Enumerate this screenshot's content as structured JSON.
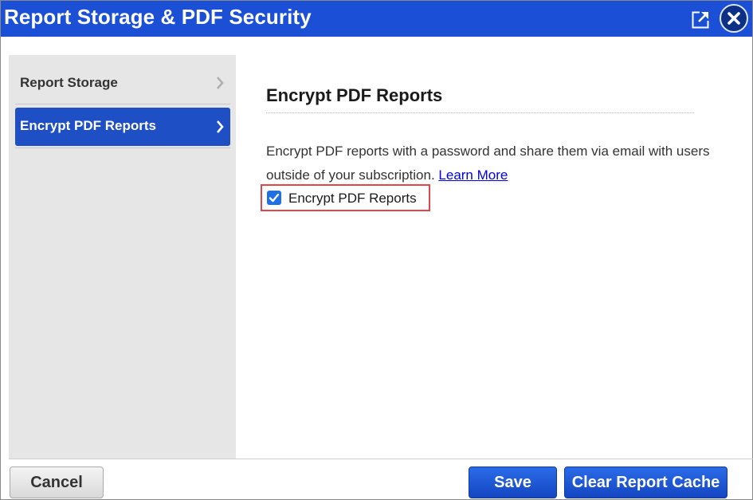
{
  "window": {
    "title": "Report Storage & PDF Security",
    "popout_icon": "popout-icon",
    "close_icon": "close-icon"
  },
  "sidebar": {
    "items": [
      {
        "label": "Report Storage",
        "selected": false
      },
      {
        "label": "Encrypt PDF Reports",
        "selected": true
      }
    ]
  },
  "main": {
    "heading": "Encrypt PDF Reports",
    "description": "Encrypt PDF reports with a password and share them via email with users outside of your subscription.",
    "learn_more": "Learn More",
    "checkbox": {
      "label": "Encrypt PDF Reports",
      "checked": true
    }
  },
  "footer": {
    "cancel_label": "Cancel",
    "save_label": "Save",
    "clear_cache_label": "Clear Report Cache"
  },
  "colors": {
    "titlebar": "#1a4fd6",
    "selected_nav": "#1e4fc4",
    "highlight_border": "#e0474c",
    "primary_button": "#1446c2"
  }
}
